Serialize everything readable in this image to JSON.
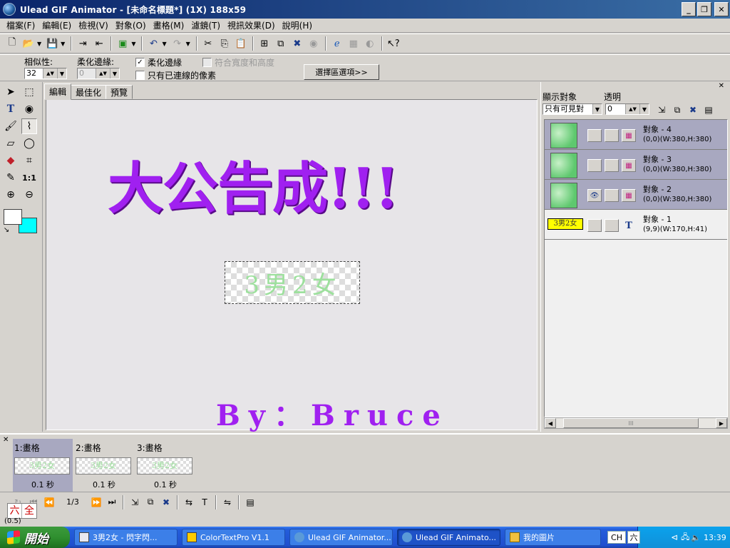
{
  "window": {
    "title": "Ulead GIF Animator - [未命名標題*] (1X) 188x59"
  },
  "menu": [
    "檔案(F)",
    "編輯(E)",
    "檢視(V)",
    "對象(O)",
    "畫格(M)",
    "濾鏡(T)",
    "視訊效果(D)",
    "說明(H)"
  ],
  "toolbar": {
    "icons": [
      "new-icon",
      "open-icon",
      "save-icon",
      "import-icon",
      "export-icon",
      "preview-icon",
      "undo-icon",
      "redo-icon",
      "cut-icon",
      "copy-icon",
      "paste-icon",
      "add-frame-icon",
      "duplicate-icon",
      "delete-icon",
      "tween-icon",
      "browser-icon",
      "optimize-icon",
      "help-icon"
    ]
  },
  "options": {
    "similarity_label": "相似性:",
    "similarity_value": "32",
    "feather_label": "柔化邊緣:",
    "feather_value": "0",
    "soft_edge_label": "柔化邊緣",
    "soft_edge_checked": "✓",
    "fit_label": "符合寬度和高度",
    "contiguous_label": "只有已連線的像素",
    "selection_options_label": "選擇區選項>>"
  },
  "tabs": [
    "編輯",
    "最佳化",
    "預覽"
  ],
  "canvas": {
    "title": "大公告成!!!",
    "selected_text": "3男2女",
    "author": "By：Bruce"
  },
  "object_panel": {
    "show_label": "顯示對象",
    "opacity_label": "透明",
    "show_value": "只有可見對",
    "opacity_value": "0",
    "objects": [
      {
        "name": "對象 - 4",
        "info": "(0,0)(W:380,H:380)"
      },
      {
        "name": "對象 - 3",
        "info": "(0,0)(W:380,H:380)"
      },
      {
        "name": "對象 - 2",
        "info": "(0,0)(W:380,H:380)"
      },
      {
        "name": "對象 - 1",
        "info": "(9,9)(W:170,H:41)",
        "thumb_text": "3男2女",
        "type_glyph": "T"
      }
    ],
    "scroll_grip": "III"
  },
  "frames": {
    "items": [
      {
        "label": "1:畫格",
        "delay": "0.1 秒",
        "thumb": "3男2女"
      },
      {
        "label": "2:畫格",
        "delay": "0.1 秒",
        "thumb": "3男2女"
      },
      {
        "label": "3:畫格",
        "delay": "0.1 秒",
        "thumb": "3男2女"
      }
    ],
    "counter": "1/3",
    "zoom": "(0.5)"
  },
  "ime": [
    "六",
    "全"
  ],
  "taskbar": {
    "start": "開始",
    "tasks": [
      {
        "label": "3男2女 - 閃字閃...",
        "color": "#e8e8f0"
      },
      {
        "label": "ColorTextPro V1.1",
        "color": "#ffcc00"
      },
      {
        "label": "Ulead GIF Animator...",
        "color": "#5a9ad8"
      },
      {
        "label": "Ulead GIF Animato...",
        "color": "#5a9ad8"
      },
      {
        "label": "我的圖片",
        "color": "#f0c040"
      }
    ],
    "lang": "CH",
    "lang2": "六",
    "clock": "13:39"
  }
}
